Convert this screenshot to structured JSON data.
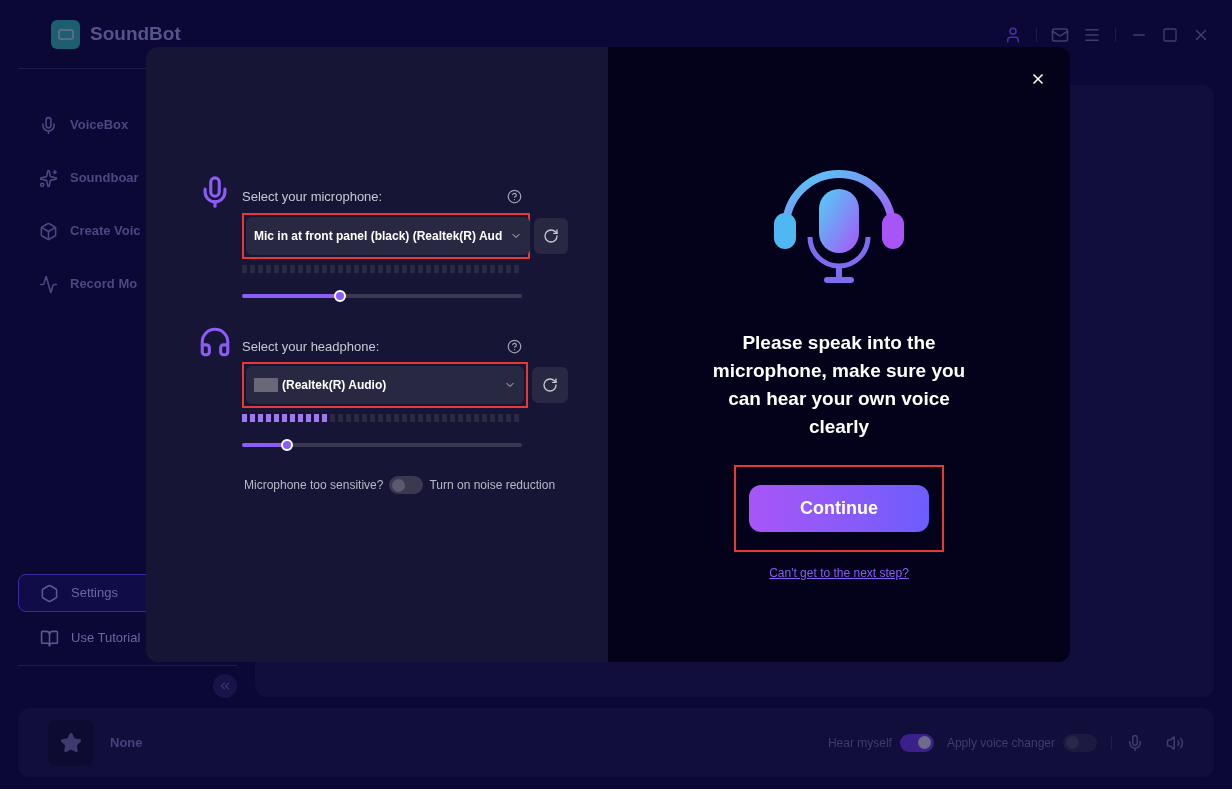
{
  "app": {
    "title": "SoundBot"
  },
  "sidebar": {
    "items": [
      {
        "label": "VoiceBox",
        "selected": false
      },
      {
        "label": "Soundboar",
        "selected": false
      },
      {
        "label": "Create Voic",
        "selected": false
      },
      {
        "label": "Record Mo",
        "selected": false
      }
    ],
    "bottom_items": [
      {
        "label": "Settings",
        "selected": true
      },
      {
        "label": "Use Tutorial",
        "selected": false
      }
    ]
  },
  "player": {
    "name": "None",
    "hear_myself": {
      "label": "Hear myself",
      "on": true
    },
    "voice_changer": {
      "label": "Apply voice changer",
      "on": false
    }
  },
  "dialog": {
    "devices": [
      {
        "kind": "mic",
        "label": "Select your microphone:",
        "value": "Mic in at front panel (black) (Realtek(R) Aud",
        "redacted_prefix": false,
        "meter": {
          "level": 0.0
        },
        "volume": {
          "level": 0.35
        }
      },
      {
        "kind": "headphone",
        "label": "Select your headphone:",
        "value": "(Realtek(R) Audio)",
        "redacted_prefix": true,
        "meter": {
          "level": 0.31
        },
        "volume": {
          "level": 0.16
        }
      }
    ],
    "noise": {
      "question": "Microphone too sensitive?",
      "label": "Turn on noise reduction",
      "on": false
    },
    "message": "Please speak into the microphone, make sure you can hear your own voice clearly",
    "button": "Continue",
    "link": "Can't get to the next step?"
  }
}
